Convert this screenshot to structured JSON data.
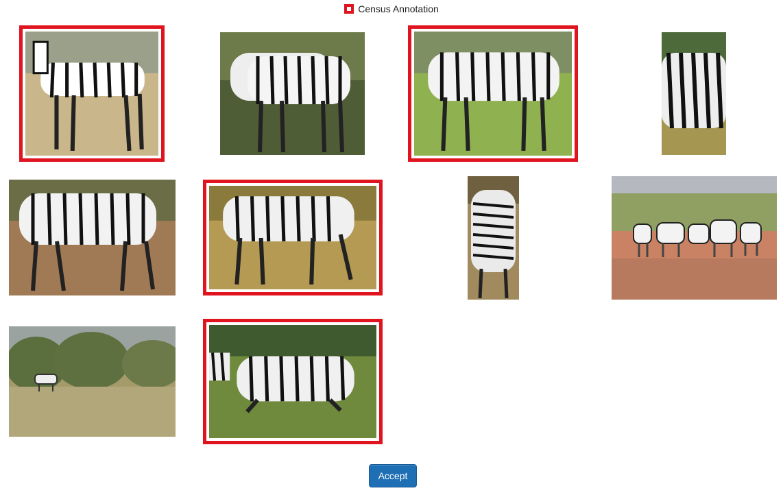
{
  "legend": {
    "label": "Census Annotation",
    "color": "#e0141e"
  },
  "accept_label": "Accept",
  "images": [
    {
      "name": "zebra-photo-1",
      "selected": true,
      "subject": "plains zebra standing, facing camera",
      "bg": [
        "#9aa08a",
        "#c9b68a"
      ]
    },
    {
      "name": "zebra-photo-2",
      "selected": false,
      "subject": "two grevy zebras grazing side by side",
      "bg": [
        "#6d7a4a",
        "#4f5d36"
      ]
    },
    {
      "name": "zebra-photo-3",
      "selected": true,
      "subject": "grevy zebra standing in green grass",
      "bg": [
        "#7e8f63",
        "#8fb150"
      ]
    },
    {
      "name": "zebra-photo-4",
      "selected": false,
      "subject": "zebra close-up partial view",
      "bg": [
        "#4d6a3a",
        "#a59652"
      ]
    },
    {
      "name": "zebra-photo-5",
      "selected": false,
      "subject": "grevy zebra walking",
      "bg": [
        "#6a6d45",
        "#a07a55"
      ]
    },
    {
      "name": "zebra-photo-6",
      "selected": true,
      "subject": "zebra grazing in dry grass",
      "bg": [
        "#8a7a3c",
        "#b49a52"
      ]
    },
    {
      "name": "zebra-photo-7",
      "selected": false,
      "subject": "zebra rear view",
      "bg": [
        "#6f6140",
        "#a08a5e"
      ]
    },
    {
      "name": "zebra-photo-8",
      "selected": false,
      "subject": "herd of zebras on red earth",
      "bg": [
        "#8fa062",
        "#c98264"
      ]
    },
    {
      "name": "zebra-photo-9",
      "selected": false,
      "subject": "distant zebra in bushland",
      "bg": [
        "#5b6e3d",
        "#a59a6a"
      ]
    },
    {
      "name": "zebra-photo-10",
      "selected": true,
      "subject": "grevy zebra lying down in grass",
      "bg": [
        "#3f5a2e",
        "#6f8a3c"
      ]
    }
  ]
}
